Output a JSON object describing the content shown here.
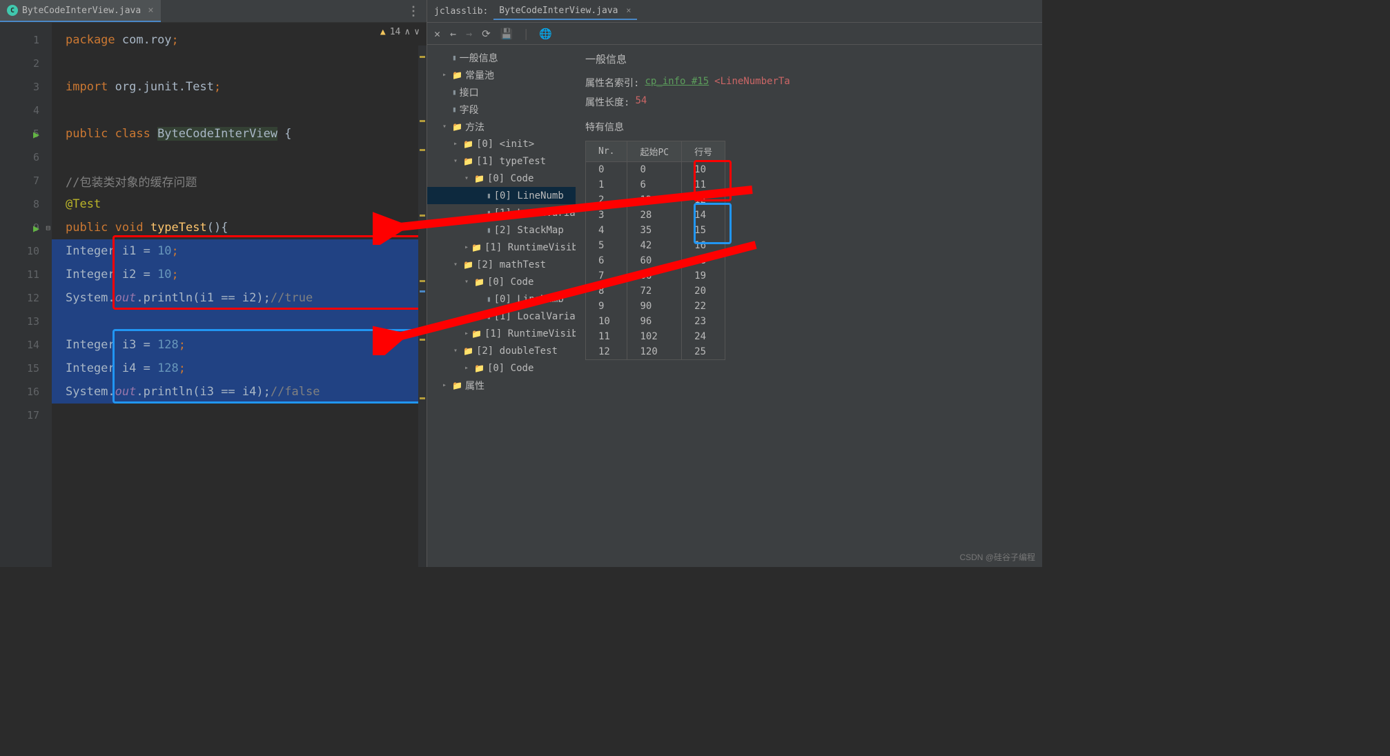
{
  "leftTab": {
    "label": "ByteCodeInterView.java",
    "warnings": "14"
  },
  "code": {
    "l1_pkg": "package",
    "l1_ns": " com.roy",
    "l1_semi": ";",
    "l3_imp": "import",
    "l3_ns": " org.junit.Test",
    "l3_semi": ";",
    "l5_pub": "public class ",
    "l5_cls": "ByteCodeInterView",
    "l5_brace": " {",
    "l7_com": "//包装类对象的缓存问题",
    "l8_ann": "@Test",
    "l9_sig": "public void ",
    "l9_name": "typeTest",
    "l9_paren": "(){",
    "l10_a": "Integer i1 = ",
    "l10_n": "10",
    "l10_s": ";",
    "l11_a": "Integer i2 = ",
    "l11_n": "10",
    "l11_s": ";",
    "l12_a": "System.",
    "l12_out": "out",
    "l12_b": ".println(i1 == i2);",
    "l12_c": "//true",
    "l14_a": "Integer i3 = ",
    "l14_n": "128",
    "l14_s": ";",
    "l15_a": "Integer i4 = ",
    "l15_n": "128",
    "l15_s": ";",
    "l16_a": "System.",
    "l16_out": "out",
    "l16_b": ".println(i3 == i4);",
    "l16_c": "//false"
  },
  "gutter": [
    "1",
    "2",
    "3",
    "4",
    "5",
    "6",
    "7",
    "8",
    "9",
    "10",
    "11",
    "12",
    "13",
    "14",
    "15",
    "16",
    "17"
  ],
  "rightHeader": {
    "prefix": "jclasslib:",
    "tab": "ByteCodeInterView.java"
  },
  "tree": [
    {
      "ind": 0,
      "icon": "file",
      "label": "一般信息"
    },
    {
      "ind": 0,
      "chev": ">",
      "icon": "folder",
      "label": "常量池"
    },
    {
      "ind": 0,
      "icon": "file",
      "label": "接口"
    },
    {
      "ind": 0,
      "icon": "file",
      "label": "字段"
    },
    {
      "ind": 0,
      "chev": "v",
      "icon": "folder",
      "label": "方法"
    },
    {
      "ind": 1,
      "chev": ">",
      "icon": "folder",
      "label": "[0] <init>"
    },
    {
      "ind": 1,
      "chev": "v",
      "icon": "folder",
      "label": "[1] typeTest"
    },
    {
      "ind": 2,
      "chev": "v",
      "icon": "folder",
      "label": "[0] Code"
    },
    {
      "ind": 3,
      "icon": "file",
      "label": "[0] LineNumb",
      "sel": true
    },
    {
      "ind": 3,
      "icon": "file",
      "label": "[1] LocalVaria"
    },
    {
      "ind": 3,
      "icon": "file",
      "label": "[2] StackMap"
    },
    {
      "ind": 2,
      "chev": ">",
      "icon": "folder",
      "label": "[1] RuntimeVisib"
    },
    {
      "ind": 1,
      "chev": "v",
      "icon": "folder",
      "label": "[2] mathTest"
    },
    {
      "ind": 2,
      "chev": "v",
      "icon": "folder",
      "label": "[0] Code"
    },
    {
      "ind": 3,
      "icon": "file",
      "label": "[0] LineNumb"
    },
    {
      "ind": 3,
      "icon": "file",
      "label": "[1] LocalVaria"
    },
    {
      "ind": 2,
      "chev": ">",
      "icon": "folder",
      "label": "[1] RuntimeVisib"
    },
    {
      "ind": 1,
      "chev": "v",
      "icon": "folder",
      "label": "[2] doubleTest"
    },
    {
      "ind": 2,
      "chev": ">",
      "icon": "folder",
      "label": "[0] Code"
    },
    {
      "ind": 0,
      "chev": ">",
      "icon": "folder",
      "label": "属性"
    }
  ],
  "detail": {
    "title": "一般信息",
    "attrNameLabel": "属性名索引:",
    "attrNameLink": "cp_info #15",
    "attrNameVal": "<LineNumberTa",
    "attrLenLabel": "属性长度:",
    "attrLenVal": "54",
    "specialTitle": "特有信息",
    "headers": [
      "Nr.",
      "起始PC",
      "行号"
    ],
    "rows": [
      [
        "0",
        "0",
        "10"
      ],
      [
        "1",
        "6",
        "11"
      ],
      [
        "2",
        "12",
        "12"
      ],
      [
        "3",
        "28",
        "14"
      ],
      [
        "4",
        "35",
        "15"
      ],
      [
        "5",
        "42",
        "16"
      ],
      [
        "6",
        "60",
        "18"
      ],
      [
        "7",
        "66",
        "19"
      ],
      [
        "8",
        "72",
        "20"
      ],
      [
        "9",
        "90",
        "22"
      ],
      [
        "10",
        "96",
        "23"
      ],
      [
        "11",
        "102",
        "24"
      ],
      [
        "12",
        "120",
        "25"
      ]
    ]
  },
  "watermark": "CSDN @硅谷子编程"
}
